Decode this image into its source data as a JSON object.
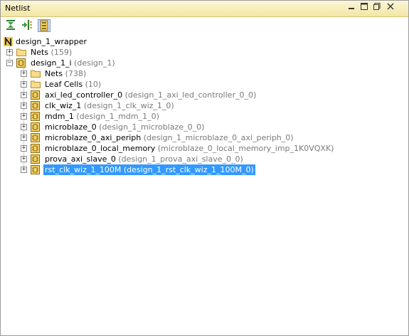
{
  "window": {
    "title": "Netlist",
    "colors": {
      "titlebar": "#f3e6a3",
      "selection": "#3399ff",
      "secondary_text": "#7a7a7a"
    }
  },
  "toolbar": {
    "buttons": [
      {
        "icon": "collapse-all-icon"
      },
      {
        "icon": "expand-all-icon"
      },
      {
        "icon": "show-hierarchy-icon",
        "active": true
      }
    ]
  },
  "tree": {
    "root": {
      "label": "design_1_wrapper",
      "icon": "netlist-n-icon"
    },
    "nets": {
      "label": "Nets",
      "count": "(159)"
    },
    "instance": {
      "label": "design_1_i",
      "sub": "(design_1)"
    },
    "children": [
      {
        "label": "Nets",
        "sub": "(738)",
        "icon": "folder-icon"
      },
      {
        "label": "Leaf Cells",
        "sub": "(10)",
        "icon": "folder-icon"
      },
      {
        "label": "axi_led_controller_0",
        "sub": "(design_1_axi_led_controller_0_0)",
        "icon": "cell-icon"
      },
      {
        "label": "clk_wiz_1",
        "sub": "(design_1_clk_wiz_1_0)",
        "icon": "cell-icon"
      },
      {
        "label": "mdm_1",
        "sub": "(design_1_mdm_1_0)",
        "icon": "cell-icon"
      },
      {
        "label": "microblaze_0",
        "sub": "(design_1_microblaze_0_0)",
        "icon": "cell-icon"
      },
      {
        "label": "microblaze_0_axi_periph",
        "sub": "(design_1_microblaze_0_axi_periph_0)",
        "icon": "cell-icon"
      },
      {
        "label": "microblaze_0_local_memory",
        "sub": "(microblaze_0_local_memory_imp_1K0VQXK)",
        "icon": "cell-icon"
      },
      {
        "label": "prova_axi_slave_0",
        "sub": "(design_1_prova_axi_slave_0_0)",
        "icon": "cell-icon"
      },
      {
        "label": "rst_clk_wiz_1_100M",
        "sub": "(design_1_rst_clk_wiz_1_100M_0)",
        "icon": "cell-icon",
        "selected": true
      }
    ]
  }
}
